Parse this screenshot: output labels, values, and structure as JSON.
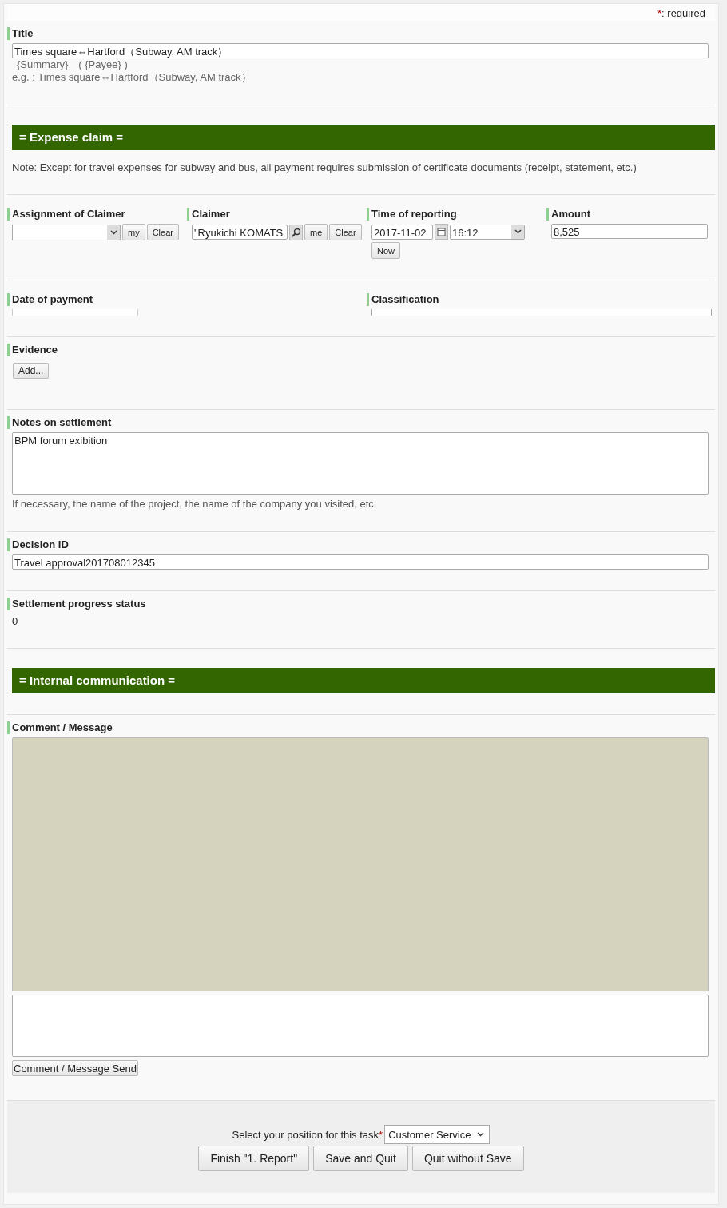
{
  "required_note": {
    "mark": "*",
    "text": ": required"
  },
  "title": {
    "label": "Title",
    "value": "Times square⇔Hartford（Subway, AM track）",
    "format": "{Summary}　( {Payee} )",
    "example": "e.g. :  Times square⇔Hartford（Subway, AM track）"
  },
  "expense_header": "= Expense claim =",
  "expense_note": "Note: Except for travel expenses for subway and bus, all payment requires submission of certificate documents (receipt, statement, etc.)",
  "assignment": {
    "label": "Assignment of Claimer",
    "buttons": [
      "my",
      "Clear"
    ]
  },
  "claimer": {
    "label": "Claimer",
    "value": "\"Ryukichi KOMATS",
    "buttons": [
      "me",
      "Clear"
    ]
  },
  "time_of_reporting": {
    "label": "Time of reporting",
    "date": "2017-11-02",
    "time": "16:12",
    "button": "Now"
  },
  "amount": {
    "label": "Amount",
    "value": "8,525"
  },
  "date_of_payment": {
    "label": "Date of payment"
  },
  "classification": {
    "label": "Classification"
  },
  "evidence": {
    "label": "Evidence",
    "button": "Add..."
  },
  "notes": {
    "label": "Notes on settlement",
    "value": "BPM forum exibition",
    "hint": "If necessary, the name of the project, the name of the company you visited, etc."
  },
  "decision": {
    "label": "Decision ID",
    "value": "Travel approval201708012345"
  },
  "progress": {
    "label": "Settlement progress status",
    "value": "0"
  },
  "internal_header": "= Internal communication =",
  "comment": {
    "label": "Comment / Message",
    "button": "Comment / Message Send"
  },
  "footer": {
    "position_label": "Select your position for this task",
    "required_mark": "*",
    "position_value": "Customer Service",
    "buttons": [
      "Finish \"1. Report\"",
      "Save and Quit",
      "Quit without Save"
    ]
  }
}
